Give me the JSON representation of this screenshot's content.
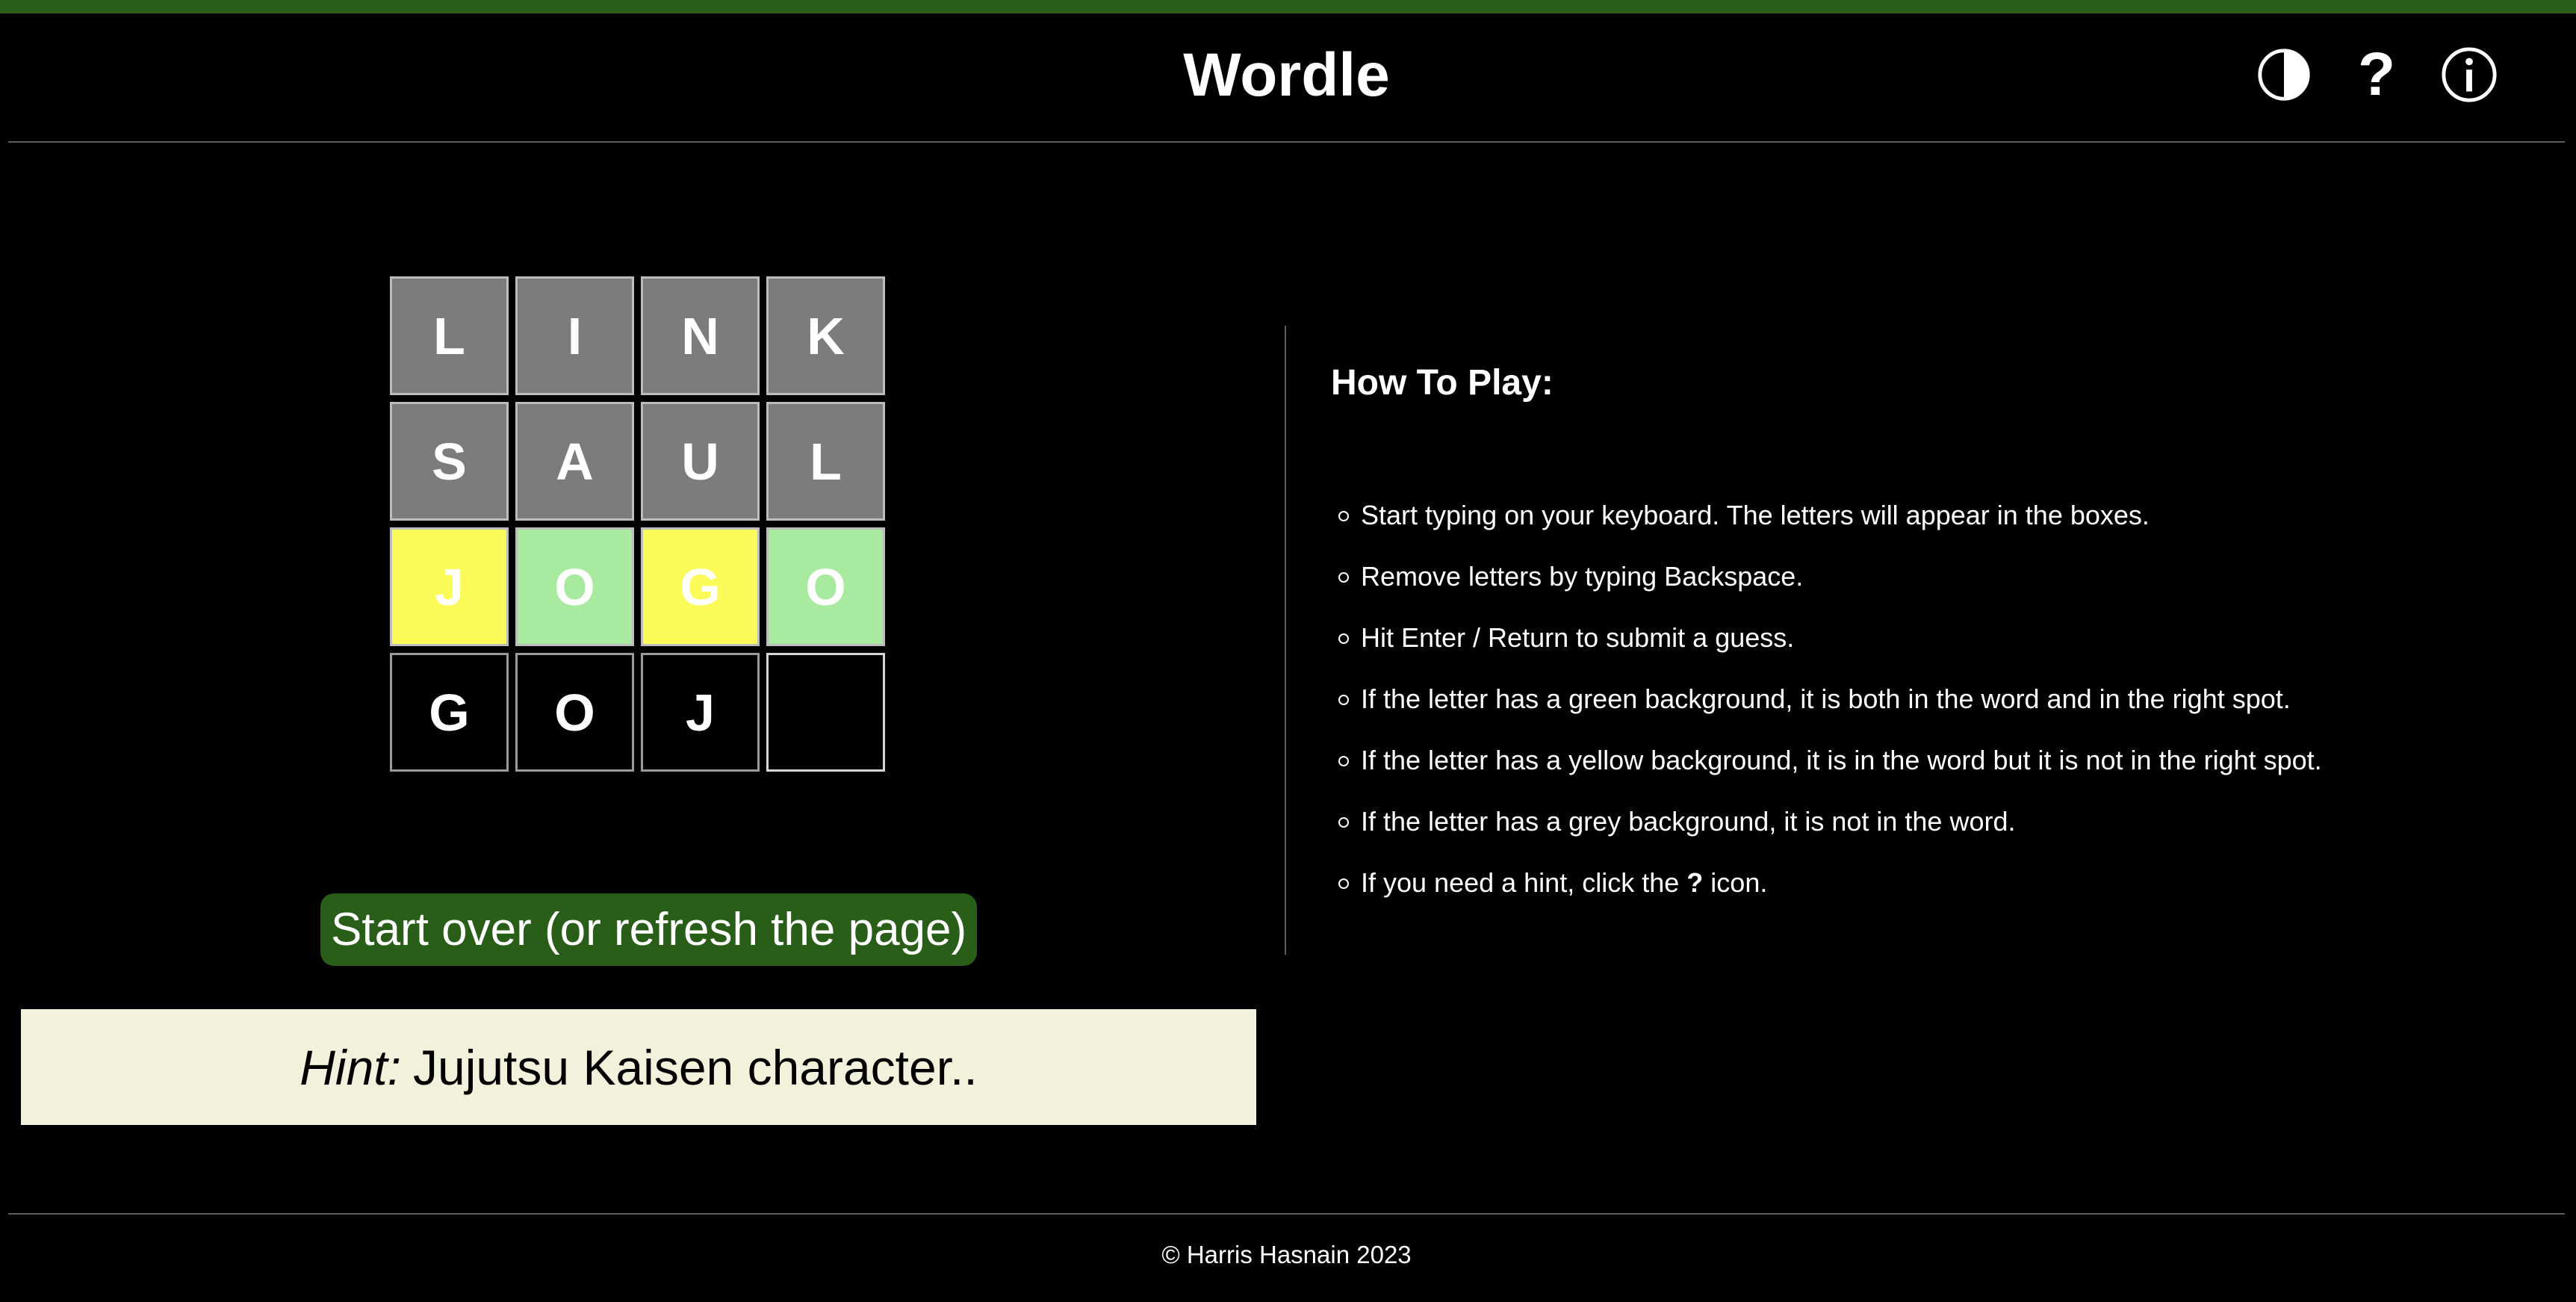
{
  "header": {
    "title": "Wordle",
    "icons": [
      "contrast-icon",
      "help-icon",
      "info-icon"
    ],
    "help_glyph": "?"
  },
  "board": {
    "rows": [
      [
        {
          "letter": "L",
          "state": "absent"
        },
        {
          "letter": "I",
          "state": "absent"
        },
        {
          "letter": "N",
          "state": "absent"
        },
        {
          "letter": "K",
          "state": "absent"
        }
      ],
      [
        {
          "letter": "S",
          "state": "absent"
        },
        {
          "letter": "A",
          "state": "absent"
        },
        {
          "letter": "U",
          "state": "absent"
        },
        {
          "letter": "L",
          "state": "absent"
        }
      ],
      [
        {
          "letter": "J",
          "state": "present"
        },
        {
          "letter": "O",
          "state": "correct"
        },
        {
          "letter": "G",
          "state": "present"
        },
        {
          "letter": "O",
          "state": "correct"
        }
      ],
      [
        {
          "letter": "G",
          "state": "current"
        },
        {
          "letter": "O",
          "state": "current"
        },
        {
          "letter": "J",
          "state": "current"
        },
        {
          "letter": "",
          "state": "empty-active"
        }
      ]
    ]
  },
  "actions": {
    "start_over_label": "Start over (or refresh the page)"
  },
  "hint": {
    "label": "Hint:",
    "text": "Jujutsu Kaisen character.."
  },
  "how_to_play": {
    "title": "How To Play:",
    "items": [
      "Start typing on your keyboard. The letters will appear in the boxes.",
      "Remove letters by typing Backspace.",
      "Hit Enter / Return to submit a guess.",
      "If the letter has a green background, it is both in the word and in the right spot.",
      "If the letter has a yellow background, it is in the word but it is not in the right spot.",
      "If the letter has a grey background, it is not in the word."
    ],
    "last_item": {
      "before": "If you need a hint, click the",
      "bold": "?",
      "after": "icon."
    }
  },
  "footer": {
    "copyright": "© Harris Hasnain 2023"
  },
  "colors": {
    "accent": "#295e19",
    "correct": "#a8eba0",
    "present": "#fafa58",
    "absent": "#7c7c7c",
    "hint_bg": "#f2f2dc"
  }
}
